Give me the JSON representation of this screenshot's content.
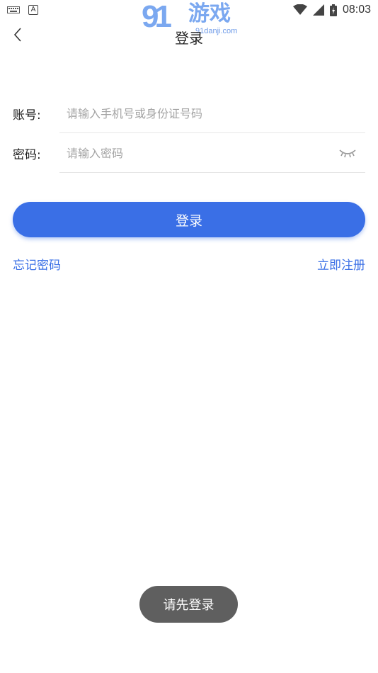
{
  "status_bar": {
    "time": "08:03",
    "icons": [
      "keyboard-icon",
      "a-icon",
      "wifi-icon",
      "cell-signal-icon",
      "battery-icon"
    ]
  },
  "watermark": {
    "digits": "91",
    "name": "游戏",
    "url": "91danji.com"
  },
  "header": {
    "title": "登录"
  },
  "form": {
    "account": {
      "label": "账号:",
      "placeholder": "请输入手机号或身份证号码",
      "value": ""
    },
    "password": {
      "label": "密码:",
      "placeholder": "请输入密码",
      "value": ""
    }
  },
  "actions": {
    "login_label": "登录",
    "forgot_label": "忘记密码",
    "register_label": "立即注册"
  },
  "toast": {
    "message": "请先登录"
  },
  "colors": {
    "accent": "#3a6fe6",
    "toast_bg": "#5f5f5f"
  }
}
